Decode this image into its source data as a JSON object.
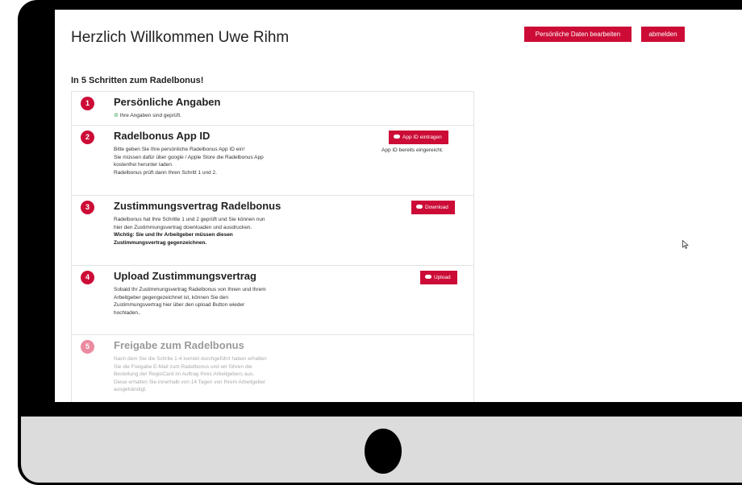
{
  "header": {
    "title": "Herzlich Willkommen Uwe Rihm",
    "edit_label": "Persönliche Daten bearbeiten",
    "logout_label": "abmelden"
  },
  "subtitle": "In 5 Schritten zum Radelbonus!",
  "steps": [
    {
      "number": "1",
      "title": "Persönliche Angaben",
      "status_text": "Ihre Angaben sind geprüft.",
      "status_icon": "check-circle-icon"
    },
    {
      "number": "2",
      "title": "Radelbonus App ID",
      "lines": [
        "Bitte geben Sie Ihre persönliche Radelbonus App ID ein!",
        "Sie müssen dafür über google / Apple Store die Radelbonus App",
        "kostenfrei herunter laden.",
        "Radelbonus prüft dann Ihren Schritt 1 und 2."
      ],
      "button_label": "App ID eintragen",
      "note": "App ID bereits eingereicht."
    },
    {
      "number": "3",
      "title": "Zustimmungsvertrag Radelbonus",
      "lines": [
        "Radelbonus hat Ihre Schritte 1 und 2 geprüft und Sie können nun",
        "hier den Zustimmungsvertrag downloaden und ausdrucken."
      ],
      "bold_lines": [
        "Wichtig: Sie und Ihr Arbeitgeber müssen diesen",
        "Zustimmungsvertrag gegenzeichnen."
      ],
      "button_label": "Download"
    },
    {
      "number": "4",
      "title": "Upload Zustimmungsvertrag",
      "lines": [
        "Sobald Ihr Zustimmungsvertrag Radelbonus von Ihnen und Ihrem",
        "Arbeitgeber gegengezeichnet ist, können Sie den",
        "Zustimmungsvertrag hier über den upload Button wieder",
        "hochladen.."
      ],
      "button_label": "Upload"
    },
    {
      "number": "5",
      "title": "Freigabe zum Radelbonus",
      "lines": [
        "Nach dem Sie die Schrite 1-4 korrekt durchgeführt haben erhalten",
        "Sie die Freigabe E-Mail zum Radelbonus und wir führen die",
        "Bestellung der RegioCard im Auftrag Ihres Arbeitgebers aus.",
        "Diese erhalten Sie innerhalb von 14 Tagen von Ihrem Arbeitgeber",
        "ausgehändigt."
      ]
    }
  ],
  "colors": {
    "accent": "#cc0c36",
    "accent_faded": "#eb8aa0",
    "success": "#2e9b43",
    "bezel": "#000000",
    "chin": "#dcdcdc"
  }
}
